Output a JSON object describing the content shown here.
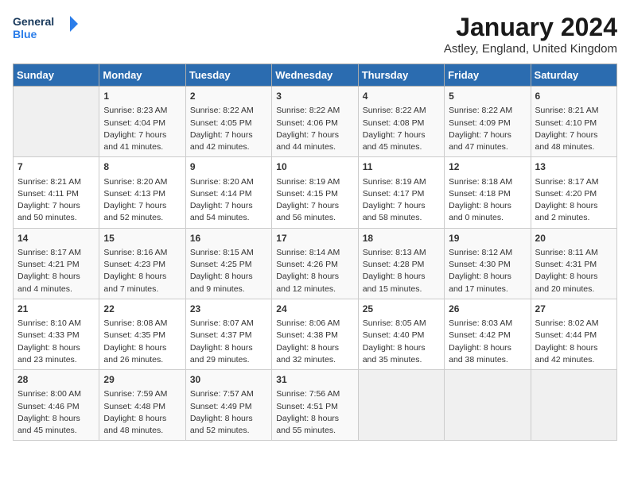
{
  "header": {
    "logo_line1": "General",
    "logo_line2": "Blue",
    "month": "January 2024",
    "location": "Astley, England, United Kingdom"
  },
  "days_of_week": [
    "Sunday",
    "Monday",
    "Tuesday",
    "Wednesday",
    "Thursday",
    "Friday",
    "Saturday"
  ],
  "weeks": [
    [
      {
        "day": "",
        "sunrise": "",
        "sunset": "",
        "daylight": ""
      },
      {
        "day": "1",
        "sunrise": "Sunrise: 8:23 AM",
        "sunset": "Sunset: 4:04 PM",
        "daylight": "Daylight: 7 hours and 41 minutes."
      },
      {
        "day": "2",
        "sunrise": "Sunrise: 8:22 AM",
        "sunset": "Sunset: 4:05 PM",
        "daylight": "Daylight: 7 hours and 42 minutes."
      },
      {
        "day": "3",
        "sunrise": "Sunrise: 8:22 AM",
        "sunset": "Sunset: 4:06 PM",
        "daylight": "Daylight: 7 hours and 44 minutes."
      },
      {
        "day": "4",
        "sunrise": "Sunrise: 8:22 AM",
        "sunset": "Sunset: 4:08 PM",
        "daylight": "Daylight: 7 hours and 45 minutes."
      },
      {
        "day": "5",
        "sunrise": "Sunrise: 8:22 AM",
        "sunset": "Sunset: 4:09 PM",
        "daylight": "Daylight: 7 hours and 47 minutes."
      },
      {
        "day": "6",
        "sunrise": "Sunrise: 8:21 AM",
        "sunset": "Sunset: 4:10 PM",
        "daylight": "Daylight: 7 hours and 48 minutes."
      }
    ],
    [
      {
        "day": "7",
        "sunrise": "Sunrise: 8:21 AM",
        "sunset": "Sunset: 4:11 PM",
        "daylight": "Daylight: 7 hours and 50 minutes."
      },
      {
        "day": "8",
        "sunrise": "Sunrise: 8:20 AM",
        "sunset": "Sunset: 4:13 PM",
        "daylight": "Daylight: 7 hours and 52 minutes."
      },
      {
        "day": "9",
        "sunrise": "Sunrise: 8:20 AM",
        "sunset": "Sunset: 4:14 PM",
        "daylight": "Daylight: 7 hours and 54 minutes."
      },
      {
        "day": "10",
        "sunrise": "Sunrise: 8:19 AM",
        "sunset": "Sunset: 4:15 PM",
        "daylight": "Daylight: 7 hours and 56 minutes."
      },
      {
        "day": "11",
        "sunrise": "Sunrise: 8:19 AM",
        "sunset": "Sunset: 4:17 PM",
        "daylight": "Daylight: 7 hours and 58 minutes."
      },
      {
        "day": "12",
        "sunrise": "Sunrise: 8:18 AM",
        "sunset": "Sunset: 4:18 PM",
        "daylight": "Daylight: 8 hours and 0 minutes."
      },
      {
        "day": "13",
        "sunrise": "Sunrise: 8:17 AM",
        "sunset": "Sunset: 4:20 PM",
        "daylight": "Daylight: 8 hours and 2 minutes."
      }
    ],
    [
      {
        "day": "14",
        "sunrise": "Sunrise: 8:17 AM",
        "sunset": "Sunset: 4:21 PM",
        "daylight": "Daylight: 8 hours and 4 minutes."
      },
      {
        "day": "15",
        "sunrise": "Sunrise: 8:16 AM",
        "sunset": "Sunset: 4:23 PM",
        "daylight": "Daylight: 8 hours and 7 minutes."
      },
      {
        "day": "16",
        "sunrise": "Sunrise: 8:15 AM",
        "sunset": "Sunset: 4:25 PM",
        "daylight": "Daylight: 8 hours and 9 minutes."
      },
      {
        "day": "17",
        "sunrise": "Sunrise: 8:14 AM",
        "sunset": "Sunset: 4:26 PM",
        "daylight": "Daylight: 8 hours and 12 minutes."
      },
      {
        "day": "18",
        "sunrise": "Sunrise: 8:13 AM",
        "sunset": "Sunset: 4:28 PM",
        "daylight": "Daylight: 8 hours and 15 minutes."
      },
      {
        "day": "19",
        "sunrise": "Sunrise: 8:12 AM",
        "sunset": "Sunset: 4:30 PM",
        "daylight": "Daylight: 8 hours and 17 minutes."
      },
      {
        "day": "20",
        "sunrise": "Sunrise: 8:11 AM",
        "sunset": "Sunset: 4:31 PM",
        "daylight": "Daylight: 8 hours and 20 minutes."
      }
    ],
    [
      {
        "day": "21",
        "sunrise": "Sunrise: 8:10 AM",
        "sunset": "Sunset: 4:33 PM",
        "daylight": "Daylight: 8 hours and 23 minutes."
      },
      {
        "day": "22",
        "sunrise": "Sunrise: 8:08 AM",
        "sunset": "Sunset: 4:35 PM",
        "daylight": "Daylight: 8 hours and 26 minutes."
      },
      {
        "day": "23",
        "sunrise": "Sunrise: 8:07 AM",
        "sunset": "Sunset: 4:37 PM",
        "daylight": "Daylight: 8 hours and 29 minutes."
      },
      {
        "day": "24",
        "sunrise": "Sunrise: 8:06 AM",
        "sunset": "Sunset: 4:38 PM",
        "daylight": "Daylight: 8 hours and 32 minutes."
      },
      {
        "day": "25",
        "sunrise": "Sunrise: 8:05 AM",
        "sunset": "Sunset: 4:40 PM",
        "daylight": "Daylight: 8 hours and 35 minutes."
      },
      {
        "day": "26",
        "sunrise": "Sunrise: 8:03 AM",
        "sunset": "Sunset: 4:42 PM",
        "daylight": "Daylight: 8 hours and 38 minutes."
      },
      {
        "day": "27",
        "sunrise": "Sunrise: 8:02 AM",
        "sunset": "Sunset: 4:44 PM",
        "daylight": "Daylight: 8 hours and 42 minutes."
      }
    ],
    [
      {
        "day": "28",
        "sunrise": "Sunrise: 8:00 AM",
        "sunset": "Sunset: 4:46 PM",
        "daylight": "Daylight: 8 hours and 45 minutes."
      },
      {
        "day": "29",
        "sunrise": "Sunrise: 7:59 AM",
        "sunset": "Sunset: 4:48 PM",
        "daylight": "Daylight: 8 hours and 48 minutes."
      },
      {
        "day": "30",
        "sunrise": "Sunrise: 7:57 AM",
        "sunset": "Sunset: 4:49 PM",
        "daylight": "Daylight: 8 hours and 52 minutes."
      },
      {
        "day": "31",
        "sunrise": "Sunrise: 7:56 AM",
        "sunset": "Sunset: 4:51 PM",
        "daylight": "Daylight: 8 hours and 55 minutes."
      },
      {
        "day": "",
        "sunrise": "",
        "sunset": "",
        "daylight": ""
      },
      {
        "day": "",
        "sunrise": "",
        "sunset": "",
        "daylight": ""
      },
      {
        "day": "",
        "sunrise": "",
        "sunset": "",
        "daylight": ""
      }
    ]
  ]
}
